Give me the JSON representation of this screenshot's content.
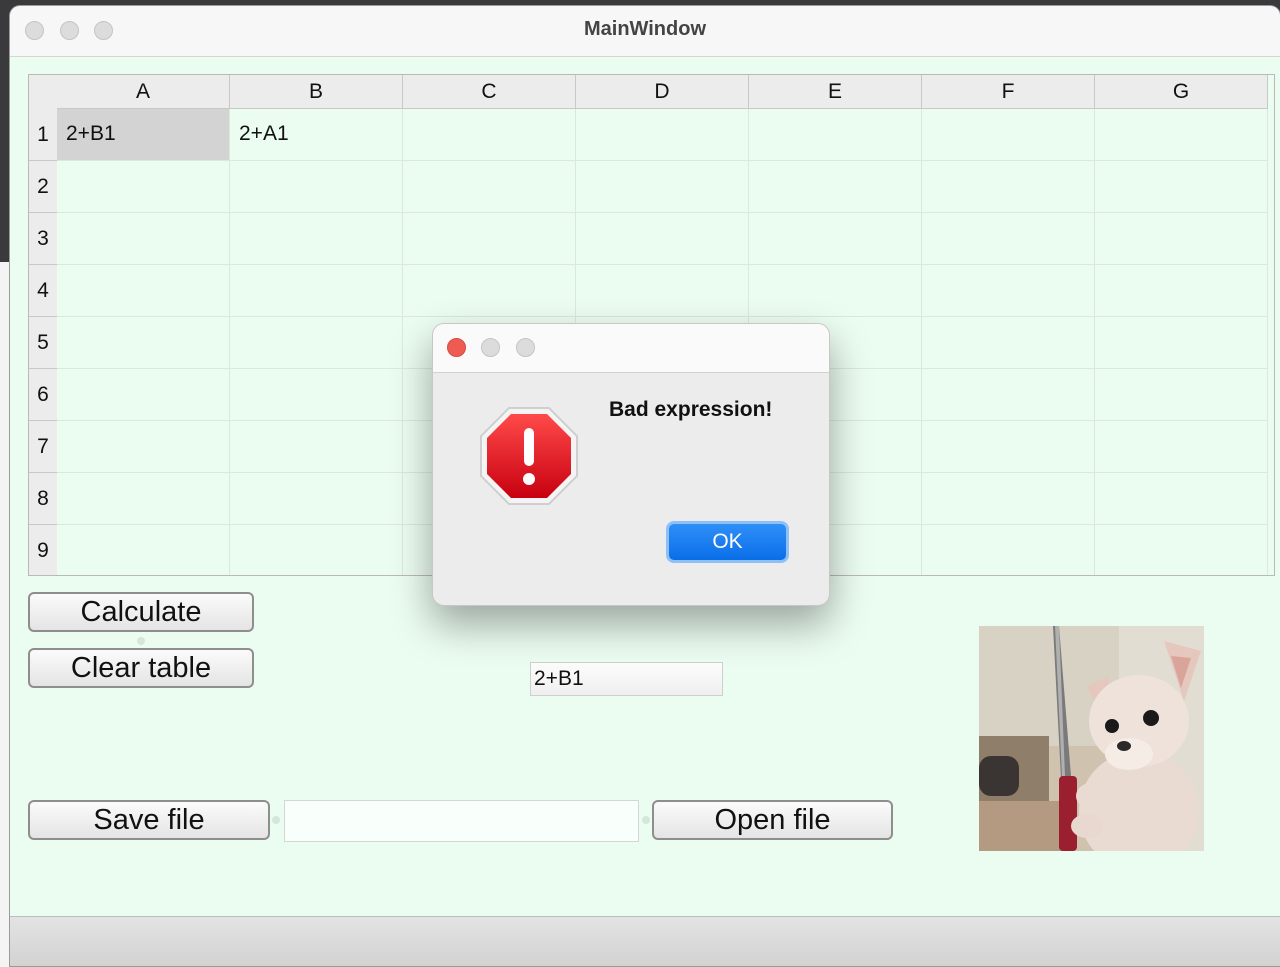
{
  "window": {
    "title": "MainWindow"
  },
  "sheet": {
    "columns": [
      "A",
      "B",
      "C",
      "D",
      "E",
      "F",
      "G"
    ],
    "rows": [
      "1",
      "2",
      "3",
      "4",
      "5",
      "6",
      "7",
      "8",
      "9"
    ],
    "cells": {
      "A1": "2+B1",
      "B1": "2+A1"
    },
    "selected": "A1"
  },
  "buttons": {
    "calculate": "Calculate",
    "clear": "Clear table",
    "save": "Save file",
    "open": "Open file"
  },
  "formula_bar": {
    "value": "2+B1"
  },
  "filename_field": {
    "value": ""
  },
  "dialog": {
    "message": "Bad expression!",
    "ok_label": "OK",
    "icon": "stop-exclamation-icon"
  },
  "colors": {
    "accent": "#0a6ee8",
    "window_bg": "#ebfcf0",
    "stop_red": "#e0101a"
  }
}
